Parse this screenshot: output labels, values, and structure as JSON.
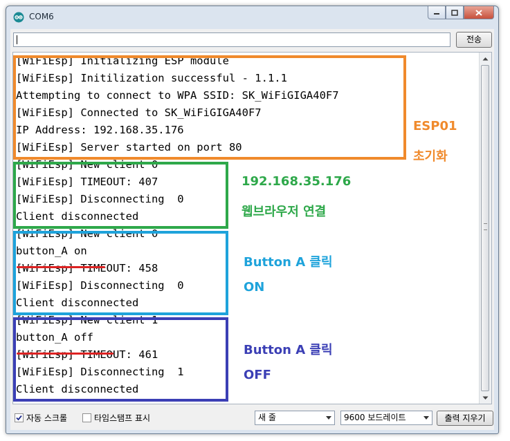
{
  "window": {
    "title": "COM6"
  },
  "toolbar": {
    "send_label": "전송",
    "input_value": ""
  },
  "console": {
    "lines": [
      "[WiFiEsp] Initializing ESP module",
      "[WiFiEsp] Initilization successful - 1.1.1",
      "Attempting to connect to WPA SSID: SK_WiFiGIGA40F7",
      "[WiFiEsp] Connected to SK_WiFiGIGA40F7",
      "IP Address: 192.168.35.176",
      "[WiFiEsp] Server started on port 80",
      "[WiFiEsp] New client 0",
      "[WiFiEsp] TIMEOUT: 407",
      "[WiFiEsp] Disconnecting  0",
      "Client disconnected",
      "[WiFiEsp] New client 0",
      "button_A on",
      "[WiFiEsp] TIMEOUT: 458",
      "[WiFiEsp] Disconnecting  0",
      "Client disconnected",
      "[WiFiEsp] New client 1",
      "button_A off",
      "[WiFiEsp] TIMEOUT: 461",
      "[WiFiEsp] Disconnecting  1",
      "Client disconnected"
    ]
  },
  "annotations": {
    "esp_title": "ESP01",
    "esp_sub": "초기화",
    "web_title": "192.168.35.176",
    "web_sub": "웹브라우저 연결",
    "on_title": "Button A 클릭",
    "on_sub": "ON",
    "off_title": "Button A 클릭",
    "off_sub": "OFF"
  },
  "colors": {
    "esp": "#f08a2c",
    "web": "#2ea84a",
    "on": "#1ea3db",
    "off": "#3b3fb5",
    "underline": "#dd2222"
  },
  "footer": {
    "autoscroll_label": "자동 스크롤",
    "autoscroll_checked": true,
    "timestamp_label": "타임스탬프 표시",
    "timestamp_checked": false,
    "line_ending": "새 줄",
    "baud": "9600 보드레이트",
    "clear_label": "출력 지우기"
  }
}
